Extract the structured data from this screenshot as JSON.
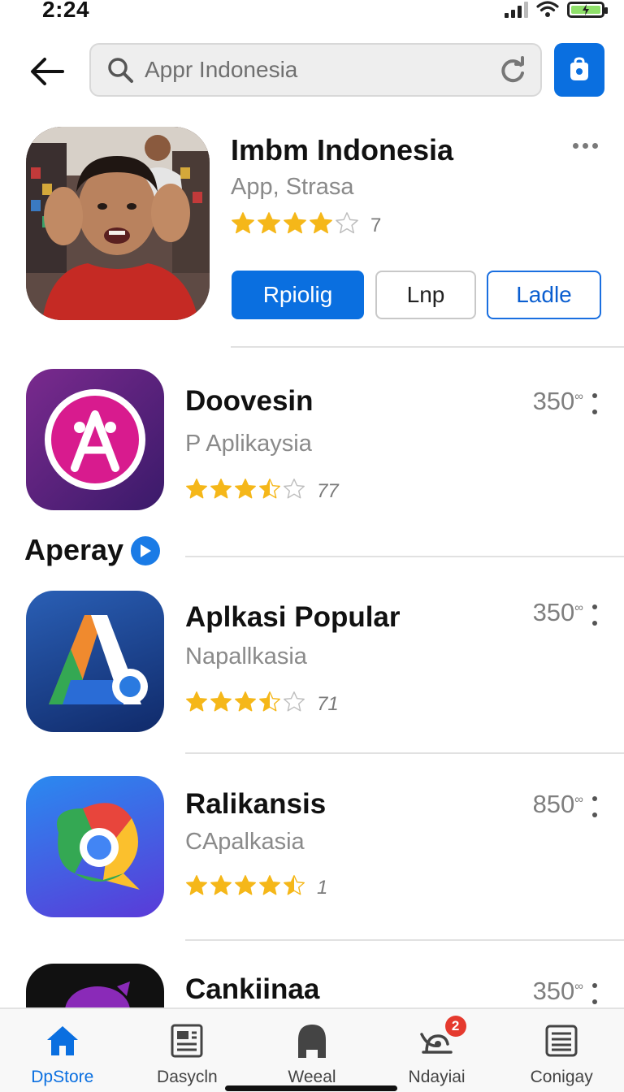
{
  "status_bar": {
    "time": "2:24"
  },
  "search": {
    "placeholder": "Appr Indonesia"
  },
  "featured": {
    "title": "Imbm Indonesia",
    "subtitle": "App, Strasa",
    "rating": 4,
    "rating_count": "7",
    "buttons": [
      "Rpiolig",
      "Lnp",
      "Ladle"
    ]
  },
  "apps_top": [
    {
      "title": "Doovesin",
      "subtitle": "P Aplikaysia",
      "price": "350",
      "price_mark": "∞",
      "rating": 3.5,
      "rating_count": "77"
    }
  ],
  "section": {
    "title": "Aperay"
  },
  "apps": [
    {
      "title": "Aplkasi Popular",
      "subtitle": "Napallkasia",
      "price": "350",
      "price_mark": "∞",
      "rating": 3.5,
      "rating_count": "71"
    },
    {
      "title": "Ralikansis",
      "subtitle": "CApalkasia",
      "price": "850",
      "price_mark": "∞",
      "rating": 4.5,
      "rating_count": "1"
    },
    {
      "title": "Cankiinaa",
      "price": "350",
      "price_mark": "∞"
    }
  ],
  "tabs": [
    {
      "label": "DpStore",
      "icon": "home-icon",
      "active": true
    },
    {
      "label": "Dasycln",
      "icon": "newspaper-icon"
    },
    {
      "label": "Weeal",
      "icon": "user-icon"
    },
    {
      "label": "Ndayiai",
      "icon": "updates-icon",
      "badge": "2"
    },
    {
      "label": "Conigay",
      "icon": "list-icon"
    }
  ],
  "colors": {
    "accent": "#0a6fe0",
    "star": "#f5b719",
    "badge": "#e53a2e"
  }
}
